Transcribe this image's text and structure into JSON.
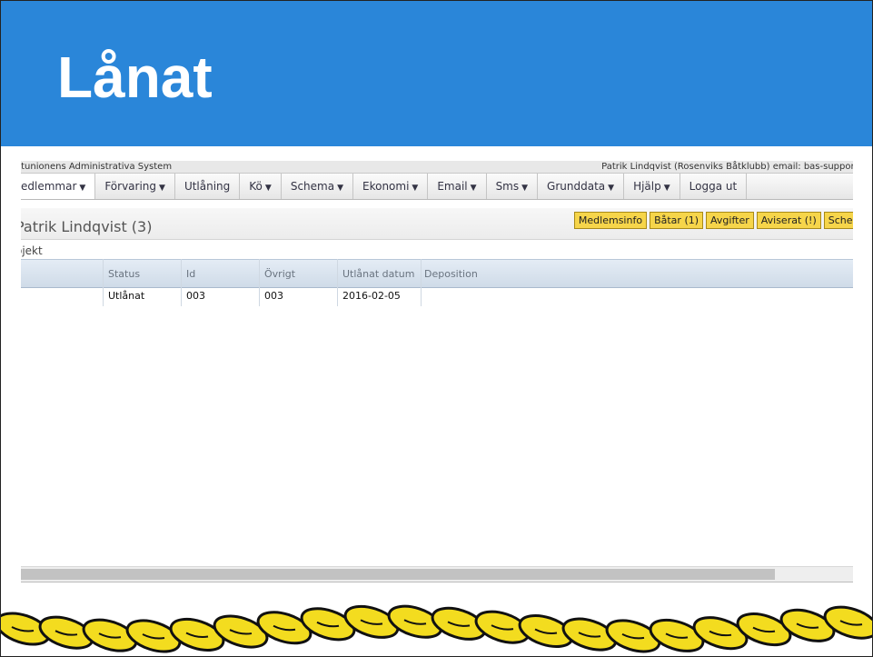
{
  "slide": {
    "title": "Lånat"
  },
  "app": {
    "name": "åtunionens Administrativa System",
    "user_info": "Patrik Lindqvist (Rosenviks Båtklubb) email: bas-support@ba"
  },
  "menu": [
    {
      "label": "edlemmar",
      "arrow": "▼"
    },
    {
      "label": "Förvaring",
      "arrow": "▼"
    },
    {
      "label": "Utlåning",
      "arrow": ""
    },
    {
      "label": "Kö",
      "arrow": "▼"
    },
    {
      "label": "Schema",
      "arrow": "▼"
    },
    {
      "label": "Ekonomi",
      "arrow": "▼"
    },
    {
      "label": "Email",
      "arrow": "▼"
    },
    {
      "label": "Sms",
      "arrow": "▼"
    },
    {
      "label": "Grunddata",
      "arrow": "▼"
    },
    {
      "label": "Hjälp",
      "arrow": "▼"
    },
    {
      "label": "Logga ut",
      "arrow": ""
    }
  ],
  "member": {
    "name": "Patrik Lindqvist (3)",
    "buttons": [
      "Medlemsinfo",
      "Båtar (1)",
      "Avgifter",
      "Aviserat (!)",
      "Schema"
    ]
  },
  "section_label": "ojekt",
  "table": {
    "columns": [
      "Status",
      "Id",
      "Övrigt",
      "Utlånat datum",
      "Deposition"
    ],
    "rows": [
      [
        "Utlånat",
        "003",
        "003",
        "2016-02-05",
        ""
      ]
    ]
  },
  "colors": {
    "title_band": "#2a86d9",
    "button_yellow": "#f6d54a",
    "rope_yellow": "#f3dc1f"
  }
}
